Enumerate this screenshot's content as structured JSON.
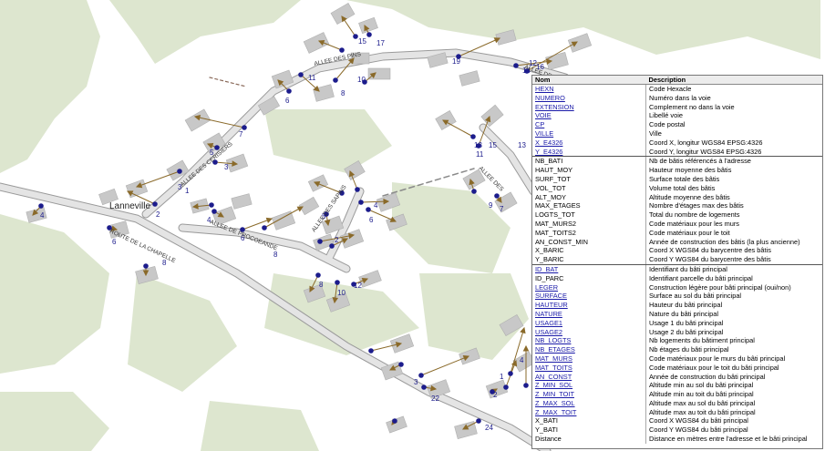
{
  "map": {
    "place_label": "Lanneville",
    "streets": [
      "ALLEE DES PINS",
      "ALLEE DES CERISIERS",
      "ROUTE DE LA CHAPELLE",
      "ALLEE DE PROCOEANDE",
      "ALLEE DES PINS",
      "ALLEE DES SAPINS",
      "ALLEE DES"
    ],
    "house_numbers": [
      "15",
      "17",
      "19",
      "10",
      "11",
      "8",
      "6",
      "7",
      "5",
      "3",
      "1",
      "2",
      "4",
      "6",
      "8",
      "5",
      "4",
      "6",
      "2",
      "3",
      "8",
      "10",
      "12",
      "13",
      "11",
      "15",
      "9",
      "7",
      "13",
      "14",
      "16",
      "4",
      "6",
      "8",
      "22",
      "24",
      "3",
      "4",
      "1",
      "2",
      "12"
    ]
  },
  "attributes": {
    "headers": {
      "name": "Nom",
      "description": "Description"
    },
    "rows": [
      {
        "name": "HEXN",
        "description": "Code Hexacle",
        "link": true
      },
      {
        "name": "NUMERO",
        "description": "Numéro dans la voie",
        "link": true
      },
      {
        "name": "EXTENSION",
        "description": "Complement no dans la voie",
        "link": true
      },
      {
        "name": "VOIE",
        "description": "Libellé voie",
        "link": true
      },
      {
        "name": "CP",
        "description": "Code postal",
        "link": true
      },
      {
        "name": "VILLE",
        "description": "Ville",
        "link": true
      },
      {
        "name": "X_E4326",
        "description": "Coord X, longitur WGS84 EPSG:4326",
        "link": true
      },
      {
        "name": "Y_E4326",
        "description": "Coord Y, longitur WGS84 EPSG:4326",
        "link": true,
        "end": true
      },
      {
        "name": "NB_BATI",
        "description": "Nb de bâtis référencés à l'adresse",
        "link": false
      },
      {
        "name": "HAUT_MOY",
        "description": "Hauteur moyenne des bâtis",
        "link": false
      },
      {
        "name": "SURF_TOT",
        "description": "Surface totale des bâtis",
        "link": false
      },
      {
        "name": "VOL_TOT",
        "description": "Volume total des bâtis",
        "link": false
      },
      {
        "name": "ALT_MOY",
        "description": "Altitude moyenne des bâtis",
        "link": false
      },
      {
        "name": "MAX_ETAGES",
        "description": "Nombre d'étages max des bâtis",
        "link": false
      },
      {
        "name": "LOGTS_TOT",
        "description": "Total du nombre de logements",
        "link": false
      },
      {
        "name": "MAT_MURS2",
        "description": "Code matériaux pour les murs",
        "link": false
      },
      {
        "name": "MAT_TOITS2",
        "description": "Code matériaux pour le toit",
        "link": false
      },
      {
        "name": "AN_CONST_MIN",
        "description": "Année de construction des bâtis (la plus ancienne)",
        "link": false
      },
      {
        "name": "X_BARIC",
        "description": "Coord X WGS84 du barycentre des bâtis",
        "link": false
      },
      {
        "name": "Y_BARIC",
        "description": "Coord Y WGS84 du barycentre des bâtis",
        "link": false,
        "end": true
      },
      {
        "name": "ID_BAT",
        "description": "Identifiant du bâti principal",
        "link": true
      },
      {
        "name": "ID_PARC",
        "description": "Identifiant parcelle du bâti principal",
        "link": false
      },
      {
        "name": "LEGER",
        "description": "Construction légère pour bâti principal (oui/non)",
        "link": true
      },
      {
        "name": "SURFACE",
        "description": "Surface au sol du bâti principal",
        "link": true
      },
      {
        "name": "HAUTEUR",
        "description": "Hauteur du bâti principal",
        "link": true
      },
      {
        "name": "NATURE",
        "description": "Nature du bâti principal",
        "link": true
      },
      {
        "name": "USAGE1",
        "description": "Usage 1 du bâti principal",
        "link": true
      },
      {
        "name": "USAGE2",
        "description": "Usage 2 du bâti principal",
        "link": true
      },
      {
        "name": "NB_LOGTS",
        "description": "Nb logements du bâtiment principal",
        "link": true
      },
      {
        "name": "NB_ETAGES",
        "description": "Nb étages du bâti principal",
        "link": true
      },
      {
        "name": "MAT_MURS",
        "description": "Code matériaux pour le murs du bâti principal",
        "link": true
      },
      {
        "name": "MAT_TOITS",
        "description": "Code matériaux pour le toit du bâti principal",
        "link": true
      },
      {
        "name": "AN_CONST",
        "description": "Année de construction du bâti principal",
        "link": true
      },
      {
        "name": "Z_MIN_SOL",
        "description": "Altitude min au sol du bâti principal",
        "link": true
      },
      {
        "name": "Z_MIN_TOIT",
        "description": "Altitude min au toit du bâti principal",
        "link": true
      },
      {
        "name": "Z_MAX_SOL",
        "description": "Altitude max au sol du bâti principal",
        "link": true
      },
      {
        "name": "Z_MAX_TOIT",
        "description": "Altitude max au toit du bâti principal",
        "link": true
      },
      {
        "name": "X_BATI",
        "description": "Coord X WGS84 du bâti principal",
        "link": false
      },
      {
        "name": "Y_BATI",
        "description": "Coord Y WGS84 du bâti principal",
        "link": false
      },
      {
        "name": "Distance",
        "description": "Distance en mètres entre l'adresse et le bâti principal",
        "link": false
      }
    ]
  },
  "colors": {
    "background": "#ffffff",
    "vegetation": "#dde6cf",
    "road": "#e4e4e4",
    "road_edge": "#9a9a9a",
    "building": "#c8c8c8",
    "point": "#1c1c8c",
    "arrow": "#8a6a2a",
    "track": "#8a8a8a"
  }
}
